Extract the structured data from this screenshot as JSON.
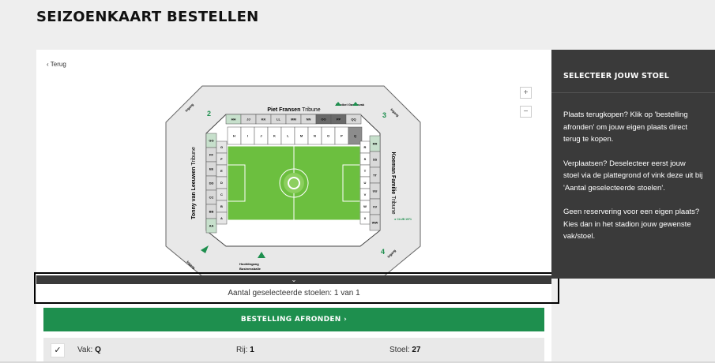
{
  "page": {
    "title": "SEIZOENKAART BESTELLEN"
  },
  "card": {
    "back_label": "Terug",
    "zoom_in": "+",
    "zoom_out": "−"
  },
  "map": {
    "stands": {
      "north": "Piet Fransen",
      "west": "Tonny van Leeuwen",
      "east": "Koeman Familie",
      "suffix": "Tribune"
    },
    "north_row": [
      "H",
      "I",
      "J",
      "K",
      "L",
      "M",
      "N",
      "O",
      "P",
      "Q"
    ],
    "north_top_row": [
      "HH",
      "JJ",
      "KK",
      "LL",
      "MM",
      "NN",
      "OO",
      "PP",
      "QQ"
    ],
    "west_col": [
      "GG",
      "FF",
      "EE",
      "DD",
      "CC",
      "BB",
      "AA"
    ],
    "west_inner": [
      "G",
      "F",
      "E",
      "D",
      "C",
      "B",
      "A"
    ],
    "east_col": [
      "RR",
      "SS",
      "TT",
      "UU",
      "VV",
      "WW"
    ],
    "east_inner": [
      "R",
      "S",
      "T",
      "U",
      "V",
      "W",
      "X"
    ],
    "labels": {
      "flexibel": "Flexibel Gastenvak",
      "hoofdingang": "Hoofdingang",
      "businessballe": "Businessballe",
      "club": "◄ CLUB 1971",
      "ingang": "Ingang"
    },
    "gates": [
      "1",
      "2",
      "3",
      "4"
    ]
  },
  "selection": {
    "collapse_icon": "⌄",
    "count_text": "Aantal geselecteerde stoelen: 1 van 1"
  },
  "order": {
    "button_label": "BESTELLING AFRONDEN  ›"
  },
  "seat": {
    "check": "✓",
    "vak_label": "Vak:",
    "vak": "Q",
    "rij_label": "Rij:",
    "rij": "1",
    "stoel_label": "Stoel:",
    "stoel": "27"
  },
  "sidebar": {
    "title": "SELECTEER JOUW STOEL",
    "paragraphs": [
      "Plaats terugkopen? Klik op 'bestelling afronden' om jouw eigen plaats direct terug te kopen.",
      "Verplaatsen? Deselecteer eerst jouw stoel via de plattegrond of vink deze uit bij 'Aantal geselecteerde stoelen'.",
      "Geen reservering voor een eigen plaats? Kies dan in het stadion jouw gewenste vak/stoel."
    ]
  },
  "colors": {
    "accent": "#1e8f4e",
    "pitch": "#6cbf3f",
    "dark": "#3a3a3a"
  }
}
